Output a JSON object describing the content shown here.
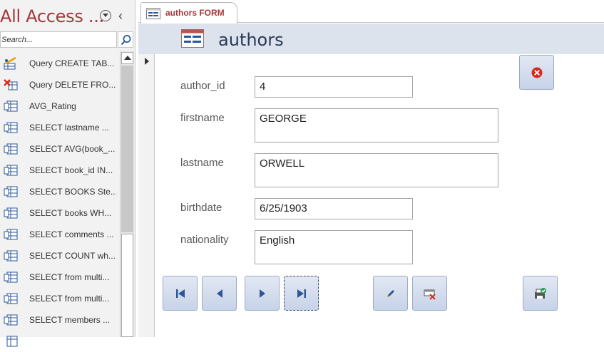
{
  "navigation": {
    "title": "All Access ...",
    "search_placeholder": "Search...",
    "items": [
      {
        "label": "Query CREATE TAB...",
        "icon": "make-table-query-icon"
      },
      {
        "label": "Query DELETE FRO...",
        "icon": "delete-query-icon"
      },
      {
        "label": "AVG_Rating",
        "icon": "query-icon"
      },
      {
        "label": "SELECT  lastname ...",
        "icon": "query-icon"
      },
      {
        "label": "SELECT AVG(book_...",
        "icon": "query-icon"
      },
      {
        "label": "SELECT book_id IN...",
        "icon": "query-icon"
      },
      {
        "label": "SELECT BOOKS Ste...",
        "icon": "query-icon"
      },
      {
        "label": "SELECT books WH...",
        "icon": "query-icon"
      },
      {
        "label": "SELECT comments ...",
        "icon": "query-icon"
      },
      {
        "label": "SELECT COUNT wh...",
        "icon": "query-icon"
      },
      {
        "label": "SELECT from multi...",
        "icon": "query-icon"
      },
      {
        "label": "SELECT from multi...",
        "icon": "query-icon"
      },
      {
        "label": "SELECT members ...",
        "icon": "query-icon"
      },
      {
        "label": "",
        "icon": "query-icon"
      }
    ]
  },
  "tab": {
    "label": "authors FORM",
    "icon": "form-icon"
  },
  "form": {
    "title": "authors",
    "fields": {
      "author_id": {
        "label": "author_id",
        "value": "4"
      },
      "firstname": {
        "label": "firstname",
        "value": "GEORGE"
      },
      "lastname": {
        "label": "lastname",
        "value": "ORWELL"
      },
      "birthdate": {
        "label": "birthdate",
        "value": "6/25/1903"
      },
      "nationality": {
        "label": "nationality",
        "value": "English"
      }
    }
  },
  "buttons": {
    "close": "close-form-icon",
    "first_record": "first-record-icon",
    "previous_record": "previous-record-icon",
    "next_record": "next-record-icon",
    "last_record": "last-record-icon",
    "edit": "edit-pencil-icon",
    "delete": "delete-record-icon",
    "save": "save-record-icon"
  },
  "colors": {
    "title_accent": "#a4373a",
    "header_band": "#dde3ec",
    "button_fill": "#c7d3e8"
  }
}
